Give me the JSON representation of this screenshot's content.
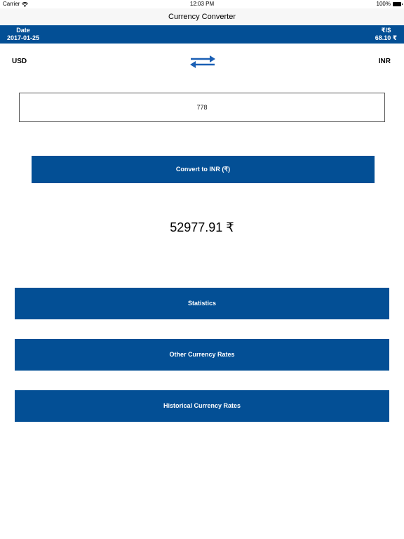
{
  "status_bar": {
    "carrier": "Carrier",
    "time": "12:03 PM",
    "battery": "100%"
  },
  "nav": {
    "title": "Currency Converter"
  },
  "rate_bar": {
    "date_caption": "Date",
    "date_value": "2017-01-25",
    "rate_caption": "₹/$",
    "rate_value": "68.10 ₹"
  },
  "currencies": {
    "from": "USD",
    "to": "INR"
  },
  "amount_input": {
    "value": "778"
  },
  "convert_button": {
    "label": "Convert to INR (₹)"
  },
  "result": {
    "text": "52977.91 ₹"
  },
  "menu": {
    "statistics_label": "Statistics",
    "other_rates_label": "Other Currency Rates",
    "historical_rates_label": "Historical Currency Rates"
  },
  "colors": {
    "primary": "#034f95",
    "nav_background": "#f7f7f7"
  },
  "icons": {
    "swap": "swap-arrows-icon",
    "wifi": "wifi-icon",
    "battery": "battery-icon"
  }
}
